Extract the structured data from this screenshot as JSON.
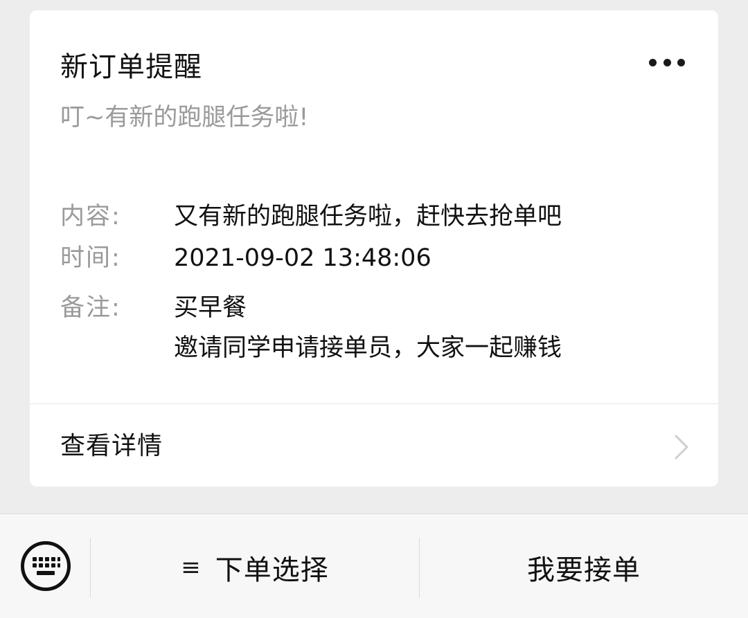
{
  "card": {
    "title": "新订单提醒",
    "subtitle": "叮~有新的跑腿任务啦!",
    "fields": [
      {
        "label": "内容:",
        "lines": [
          "又有新的跑腿任务啦，赶快去抢单吧"
        ]
      },
      {
        "label": "时间:",
        "lines": [
          "2021-09-02 13:48:06"
        ]
      },
      {
        "label": "备注:",
        "lines": [
          "买早餐",
          "邀请同学申请接单员，大家一起赚钱"
        ]
      }
    ],
    "detail_label": "查看详情",
    "more_icon": "more-dots-icon",
    "chevron_icon": "chevron-right-icon"
  },
  "bottom_bar": {
    "keyboard_icon": "keyboard-icon",
    "menu_icon": "menu-lines-icon",
    "menu_symbol": "≡",
    "order_select_label": "下单选择",
    "take_order_label": "我要接单"
  },
  "colors": {
    "background": "#ededed",
    "card": "#ffffff",
    "primary_text": "#111111",
    "secondary_text": "#9a9a9a",
    "bar": "#f7f7f7"
  }
}
